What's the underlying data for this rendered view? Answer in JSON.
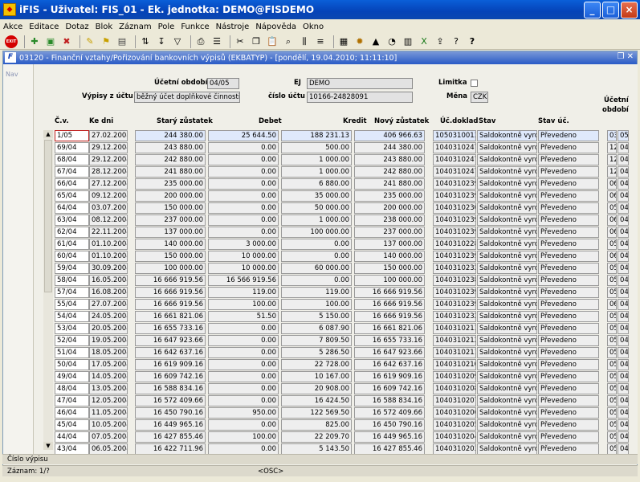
{
  "window": {
    "title": "iFIS - Uživatel: FIS_01 - Ek. jednotka: DEMO@FISDEMO"
  },
  "menu": [
    "Akce",
    "Editace",
    "Dotaz",
    "Blok",
    "Záznam",
    "Pole",
    "Funkce",
    "Nástroje",
    "Nápověda",
    "Okno"
  ],
  "toolbar": {
    "exit_label": "EXIT"
  },
  "form": {
    "title": "03120 - Finanční vztahy/Pořizování bankovních výpisů (EKBATYP) - [pondělí, 19.04.2010; 11:11:10]",
    "nav_label": "Nav",
    "obdobi_label": "Účetní období",
    "obdobi_value": "04/05",
    "ej_label": "EJ",
    "ej_value": "DEMO",
    "limitka_label": "Limitka",
    "vypisy_label": "Výpisy z účtu",
    "vypisy_value": "běžný účet doplňkové činnosti",
    "cislo_uctu_label": "číslo účtu",
    "cislo_uctu_value": "10166-24828091",
    "mena_label": "Měna",
    "mena_value": "CZK"
  },
  "table": {
    "headers": {
      "cv": "Č.v.",
      "ke_dni": "Ke dni",
      "stary": "Starý zůstatek",
      "debet": "Debet",
      "kredit": "Kredit",
      "novy": "Nový zůstatek",
      "ucdoklad": "Úč.doklad",
      "stav": "Stav",
      "stav_uc": "Stav úč.",
      "uc_obdobi_1": "Účetní",
      "uc_obdobi_2": "období"
    },
    "rows": [
      {
        "cv": "1/05",
        "date": "27.02.2008",
        "stary": "244 380.00",
        "debet": "25 644.50",
        "kredit": "188 231.13",
        "novy": "406 966.63",
        "doklad": "1050310013",
        "stav": "Saldokontně vyrovnáno",
        "stav_uc": "Převedeno",
        "o1": "03",
        "o2": "05"
      },
      {
        "cv": "69/04",
        "date": "29.12.2004",
        "stary": "243 880.00",
        "debet": "0.00",
        "kredit": "500.00",
        "novy": "244 380.00",
        "doklad": "1040310247",
        "stav": "Saldokontně vyrovnáno",
        "stav_uc": "Převedeno",
        "o1": "12",
        "o2": "04"
      },
      {
        "cv": "68/04",
        "date": "29.12.2004",
        "stary": "242 880.00",
        "debet": "0.00",
        "kredit": "1 000.00",
        "novy": "243 880.00",
        "doklad": "1040310247",
        "stav": "Saldokontně vyrovnáno",
        "stav_uc": "Převedeno",
        "o1": "12",
        "o2": "04"
      },
      {
        "cv": "67/04",
        "date": "28.12.2004",
        "stary": "241 880.00",
        "debet": "0.00",
        "kredit": "1 000.00",
        "novy": "242 880.00",
        "doklad": "1040310247",
        "stav": "Saldokontně vyrovnáno",
        "stav_uc": "Převedeno",
        "o1": "12",
        "o2": "04"
      },
      {
        "cv": "66/04",
        "date": "27.12.2004",
        "stary": "235 000.00",
        "debet": "0.00",
        "kredit": "6 880.00",
        "novy": "241 880.00",
        "doklad": "1040310239",
        "stav": "Saldokontně vyrovnáno",
        "stav_uc": "Převedeno",
        "o1": "06",
        "o2": "04"
      },
      {
        "cv": "65/04",
        "date": "09.12.2004",
        "stary": "200 000.00",
        "debet": "0.00",
        "kredit": "35 000.00",
        "novy": "235 000.00",
        "doklad": "1040310239",
        "stav": "Saldokontně vyrovnáno",
        "stav_uc": "Převedeno",
        "o1": "06",
        "o2": "04"
      },
      {
        "cv": "64/04",
        "date": "03.07.2005",
        "stary": "150 000.00",
        "debet": "0.00",
        "kredit": "50 000.00",
        "novy": "200 000.00",
        "doklad": "1040310230",
        "stav": "Saldokontně vyrovnáno",
        "stav_uc": "Převedeno",
        "o1": "05",
        "o2": "04"
      },
      {
        "cv": "63/04",
        "date": "08.12.2004",
        "stary": "237 000.00",
        "debet": "0.00",
        "kredit": "1 000.00",
        "novy": "238 000.00",
        "doklad": "1040310239",
        "stav": "Saldokontně vyrovnáno",
        "stav_uc": "Převedeno",
        "o1": "06",
        "o2": "04"
      },
      {
        "cv": "62/04",
        "date": "22.11.2004",
        "stary": "137 000.00",
        "debet": "0.00",
        "kredit": "100 000.00",
        "novy": "237 000.00",
        "doklad": "1040310239",
        "stav": "Saldokontně vyrovnáno",
        "stav_uc": "Převedeno",
        "o1": "06",
        "o2": "04"
      },
      {
        "cv": "61/04",
        "date": "01.10.2004",
        "stary": "140 000.00",
        "debet": "3 000.00",
        "kredit": "0.00",
        "novy": "137 000.00",
        "doklad": "1040310228",
        "stav": "Saldokontně vyrovnáno",
        "stav_uc": "Převedeno",
        "o1": "05",
        "o2": "04"
      },
      {
        "cv": "60/04",
        "date": "01.10.2004",
        "stary": "150 000.00",
        "debet": "10 000.00",
        "kredit": "0.00",
        "novy": "140 000.00",
        "doklad": "1040310239",
        "stav": "Saldokontně vyrovnáno",
        "stav_uc": "Převedeno",
        "o1": "06",
        "o2": "04"
      },
      {
        "cv": "59/04",
        "date": "30.09.2004",
        "stary": "100 000.00",
        "debet": "10 000.00",
        "kredit": "60 000.00",
        "novy": "150 000.00",
        "doklad": "1040310232",
        "stav": "Saldokontně vyrovnáno",
        "stav_uc": "Převedeno",
        "o1": "05",
        "o2": "04"
      },
      {
        "cv": "58/04",
        "date": "16.05.2004",
        "stary": "16 666 919.56",
        "debet": "16 566 919.56",
        "kredit": "0.00",
        "novy": "100 000.00",
        "doklad": "1040310238",
        "stav": "Saldokontně vyrovnáno",
        "stav_uc": "Převedeno",
        "o1": "05",
        "o2": "04"
      },
      {
        "cv": "57/04",
        "date": "16.08.2004",
        "stary": "16 666 919.56",
        "debet": "119.00",
        "kredit": "119.00",
        "novy": "16 666 919.56",
        "doklad": "1040310239",
        "stav": "Saldokontně vyrovnáno",
        "stav_uc": "Převedeno",
        "o1": "05",
        "o2": "04"
      },
      {
        "cv": "55/04",
        "date": "27.07.2004",
        "stary": "16 666 919.56",
        "debet": "100.00",
        "kredit": "100.00",
        "novy": "16 666 919.56",
        "doklad": "1040310239",
        "stav": "Saldokontně vyrovnáno",
        "stav_uc": "Převedeno",
        "o1": "06",
        "o2": "04"
      },
      {
        "cv": "54/04",
        "date": "24.05.2004",
        "stary": "16 661 821.06",
        "debet": "51.50",
        "kredit": "5 150.00",
        "novy": "16 666 919.56",
        "doklad": "1040310232",
        "stav": "Saldokontně vyrovnáno",
        "stav_uc": "Převedeno",
        "o1": "05",
        "o2": "04"
      },
      {
        "cv": "53/04",
        "date": "20.05.2004",
        "stary": "16 655 733.16",
        "debet": "0.00",
        "kredit": "6 087.90",
        "novy": "16 661 821.06",
        "doklad": "1040310213",
        "stav": "Saldokontně vyrovnáno",
        "stav_uc": "Převedeno",
        "o1": "05",
        "o2": "04"
      },
      {
        "cv": "52/04",
        "date": "19.05.2004",
        "stary": "16 647 923.66",
        "debet": "0.00",
        "kredit": "7 809.50",
        "novy": "16 655 733.16",
        "doklad": "1040310212",
        "stav": "Saldokontně vyrovnáno",
        "stav_uc": "Převedeno",
        "o1": "05",
        "o2": "04"
      },
      {
        "cv": "51/04",
        "date": "18.05.2004",
        "stary": "16 642 637.16",
        "debet": "0.00",
        "kredit": "5 286.50",
        "novy": "16 647 923.66",
        "doklad": "1040310211",
        "stav": "Saldokontně vyrovnáno",
        "stav_uc": "Převedeno",
        "o1": "05",
        "o2": "04"
      },
      {
        "cv": "50/04",
        "date": "17.05.2004",
        "stary": "16 619 909.16",
        "debet": "0.00",
        "kredit": "22 728.00",
        "novy": "16 642 637.16",
        "doklad": "1040310210",
        "stav": "Saldokontně vyrovnáno",
        "stav_uc": "Převedeno",
        "o1": "05",
        "o2": "04"
      },
      {
        "cv": "49/04",
        "date": "14.05.2004",
        "stary": "16 609 742.16",
        "debet": "0.00",
        "kredit": "10 167.00",
        "novy": "16 619 909.16",
        "doklad": "1040310209",
        "stav": "Saldokontně vyrovnáno",
        "stav_uc": "Převedeno",
        "o1": "05",
        "o2": "04"
      },
      {
        "cv": "48/04",
        "date": "13.05.2004",
        "stary": "16 588 834.16",
        "debet": "0.00",
        "kredit": "20 908.00",
        "novy": "16 609 742.16",
        "doklad": "1040310208",
        "stav": "Saldokontně vyrovnáno",
        "stav_uc": "Převedeno",
        "o1": "05",
        "o2": "04"
      },
      {
        "cv": "47/04",
        "date": "12.05.2004",
        "stary": "16 572 409.66",
        "debet": "0.00",
        "kredit": "16 424.50",
        "novy": "16 588 834.16",
        "doklad": "1040310207",
        "stav": "Saldokontně vyrovnáno",
        "stav_uc": "Převedeno",
        "o1": "05",
        "o2": "04"
      },
      {
        "cv": "46/04",
        "date": "11.05.2004",
        "stary": "16 450 790.16",
        "debet": "950.00",
        "kredit": "122 569.50",
        "novy": "16 572 409.66",
        "doklad": "1040310206",
        "stav": "Saldokontně vyrovnáno",
        "stav_uc": "Převedeno",
        "o1": "05",
        "o2": "04"
      },
      {
        "cv": "45/04",
        "date": "10.05.2004",
        "stary": "16 449 965.16",
        "debet": "0.00",
        "kredit": "825.00",
        "novy": "16 450 790.16",
        "doklad": "1040310205",
        "stav": "Saldokontně vyrovnáno",
        "stav_uc": "Převedeno",
        "o1": "05",
        "o2": "04"
      },
      {
        "cv": "44/04",
        "date": "07.05.2004",
        "stary": "16 427 855.46",
        "debet": "100.00",
        "kredit": "22 209.70",
        "novy": "16 449 965.16",
        "doklad": "1040310204",
        "stav": "Saldokontně vyrovnáno",
        "stav_uc": "Převedeno",
        "o1": "05",
        "o2": "04"
      },
      {
        "cv": "43/04",
        "date": "06.05.2004",
        "stary": "16 422 711.96",
        "debet": "0.00",
        "kredit": "5 143.50",
        "novy": "16 427 855.46",
        "doklad": "1040310203",
        "stav": "Saldokontně vyrovnáno",
        "stav_uc": "Převedeno",
        "o1": "05",
        "o2": "04"
      }
    ]
  },
  "status": {
    "field_hint": "Číslo výpisu",
    "record": "Záznam: 1/?",
    "osc": "<OSC>"
  }
}
